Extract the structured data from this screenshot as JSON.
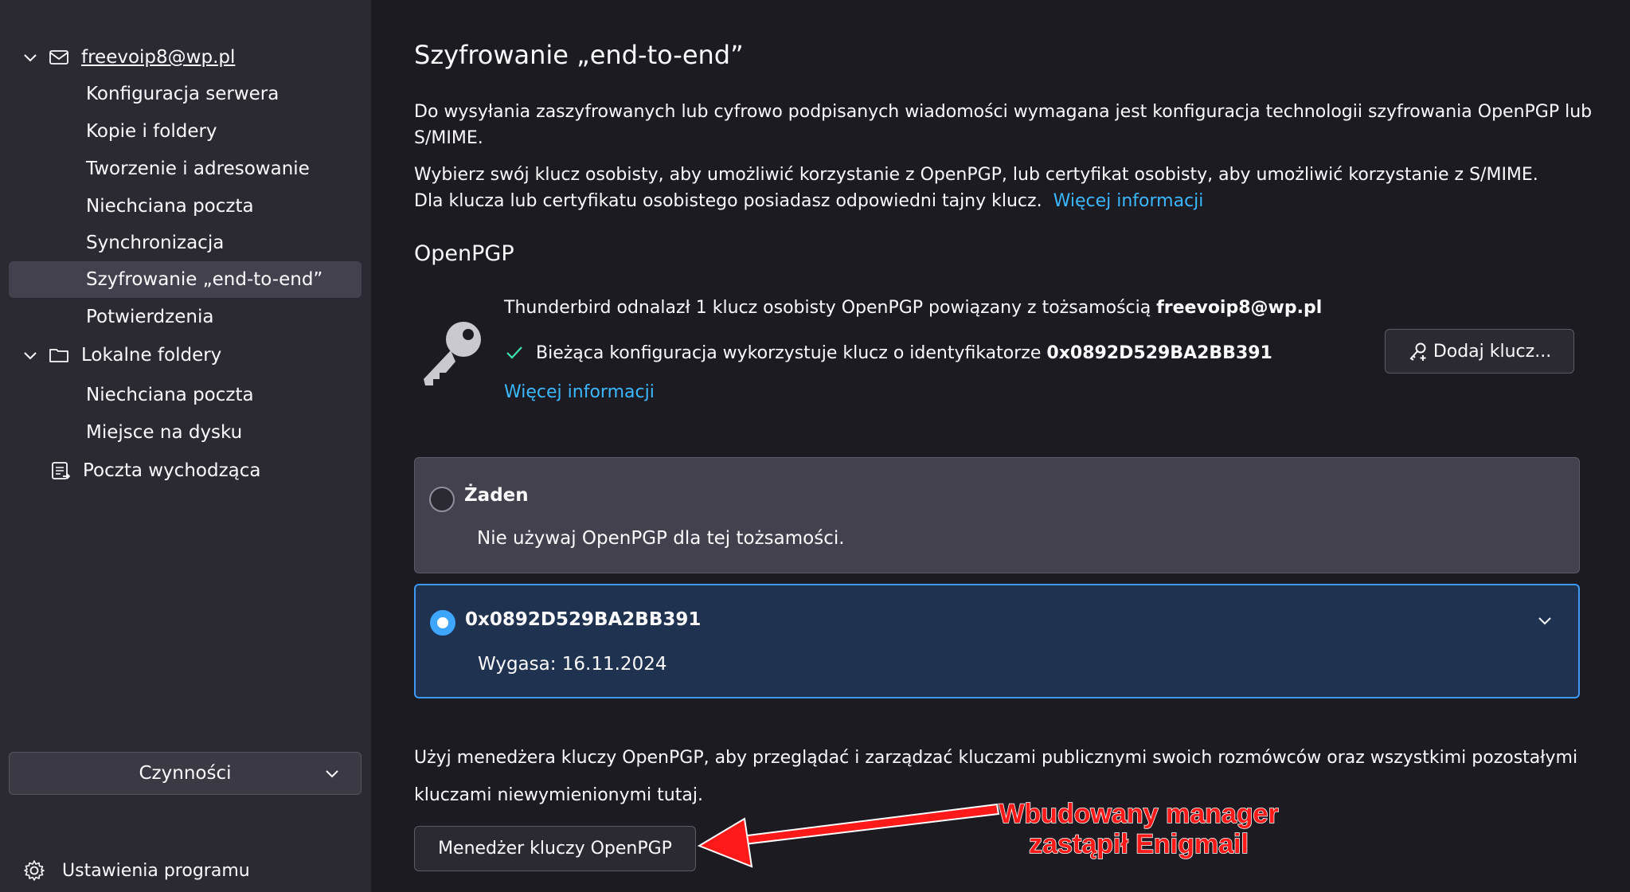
{
  "sidebar": {
    "account_label": "freevoip8@wp.pl",
    "account_items": [
      {
        "label": "Konfiguracja serwera"
      },
      {
        "label": "Kopie i foldery"
      },
      {
        "label": "Tworzenie i adresowanie"
      },
      {
        "label": "Niechciana poczta"
      },
      {
        "label": "Synchronizacja"
      },
      {
        "label": "Szyfrowanie „end-to-end”"
      },
      {
        "label": "Potwierdzenia"
      }
    ],
    "local_label": "Lokalne foldery",
    "local_items": [
      {
        "label": "Niechciana poczta"
      },
      {
        "label": "Miejsce na dysku"
      }
    ],
    "outgoing_label": "Poczta wychodząca",
    "actions_label": "Czynności",
    "settings_label": "Ustawienia programu"
  },
  "main": {
    "title": "Szyfrowanie „end-to-end”",
    "intro_p1": "Do wysyłania zaszyfrowanych lub cyfrowo podpisanych wiadomości wymagana jest konfiguracja technologii szyfrowania OpenPGP lub S/MIME.",
    "intro_p2_line1": "Wybierz swój klucz osobisty, aby umożliwić korzystanie z OpenPGP, lub certyfikat osobisty, aby umożliwić korzystanie z S/MIME.",
    "intro_p2_line2": "Dla klucza lub certyfikatu osobistego posiadasz odpowiedni tajny klucz.",
    "intro_link": "Więcej informacji",
    "openpgp_heading": "OpenPGP",
    "found_text": "Thunderbird odnalazł 1 klucz osobisty OpenPGP powiązany z tożsamością",
    "found_identity": "freevoip8@wp.pl",
    "current_text": "Bieżąca konfiguracja wykorzystuje klucz o identyfikatorze",
    "current_key": "0x0892D529BA2BB391",
    "more_info": "Więcej informacji",
    "add_key_button": "Dodaj klucz...",
    "option_none_title": "Żaden",
    "option_none_desc": "Nie używaj OpenPGP dla tej tożsamości.",
    "option_key_title": "0x0892D529BA2BB391",
    "option_key_desc": "Wygasa: 16.11.2024",
    "manager_text": "Użyj menedżera kluczy OpenPGP, aby przeglądać i zarządzać kluczami publicznymi swoich rozmówców oraz wszystkimi pozostałymi kluczami niewymienionymi tutaj.",
    "manager_button": "Menedżer kluczy OpenPGP"
  },
  "annotation": {
    "line1": "Wbudowany manager",
    "line2": "zastąpił Enigmail",
    "color": "#ff1a1a"
  },
  "colors": {
    "sidebar_bg": "#2b2a33",
    "content_bg": "#1c1b22",
    "selected_bg": "#42414d",
    "link": "#3bb8ff",
    "accent": "#3ea6ff",
    "check": "#3fe1b0"
  }
}
